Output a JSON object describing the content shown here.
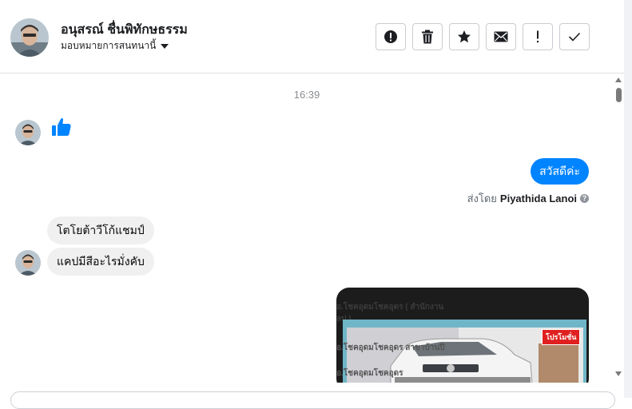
{
  "contact": {
    "name": "อนุสรณ์ ชื่นพิทักษธรรม",
    "assignee_label": "มอบหมายการสนทนานี้"
  },
  "toolbar": {
    "actions": [
      {
        "icon": "alert-circle-icon",
        "label": "Mark as spam"
      },
      {
        "icon": "trash-icon",
        "label": "Delete"
      },
      {
        "icon": "star-icon",
        "label": "Star"
      },
      {
        "icon": "envelope-icon",
        "label": "Mark as unread"
      },
      {
        "icon": "exclamation-icon",
        "label": "Follow up"
      },
      {
        "icon": "check-icon",
        "label": "Mark as done"
      }
    ]
  },
  "thread": {
    "timestamp": "16:39",
    "incoming_like": "thumbs-up",
    "outgoing_text": "สวัสดีค่ะ",
    "sent_by_prefix": "ส่งโดย",
    "sent_by_name": "Piyathida Lanoi",
    "incoming_messages": [
      "โตโยต้าวีโก้แชมป์",
      "แคปมีสีอะไรมั่งคับ"
    ],
    "image_card": {
      "text_lines": [
        "อ.โชคอุดมโชคอุดร ( สำนักงาน",
        "ลป )",
        "อ.โชคอุดมโชคอุดร สาขาบ้านปึ",
        "อ.โชคอุดมโชคอุดร"
      ],
      "promo_badge": "โปรโมชั่น"
    }
  },
  "colors": {
    "accent": "#0084ff",
    "incoming_bubble": "#f0f0f0",
    "promo": "#e02020"
  }
}
